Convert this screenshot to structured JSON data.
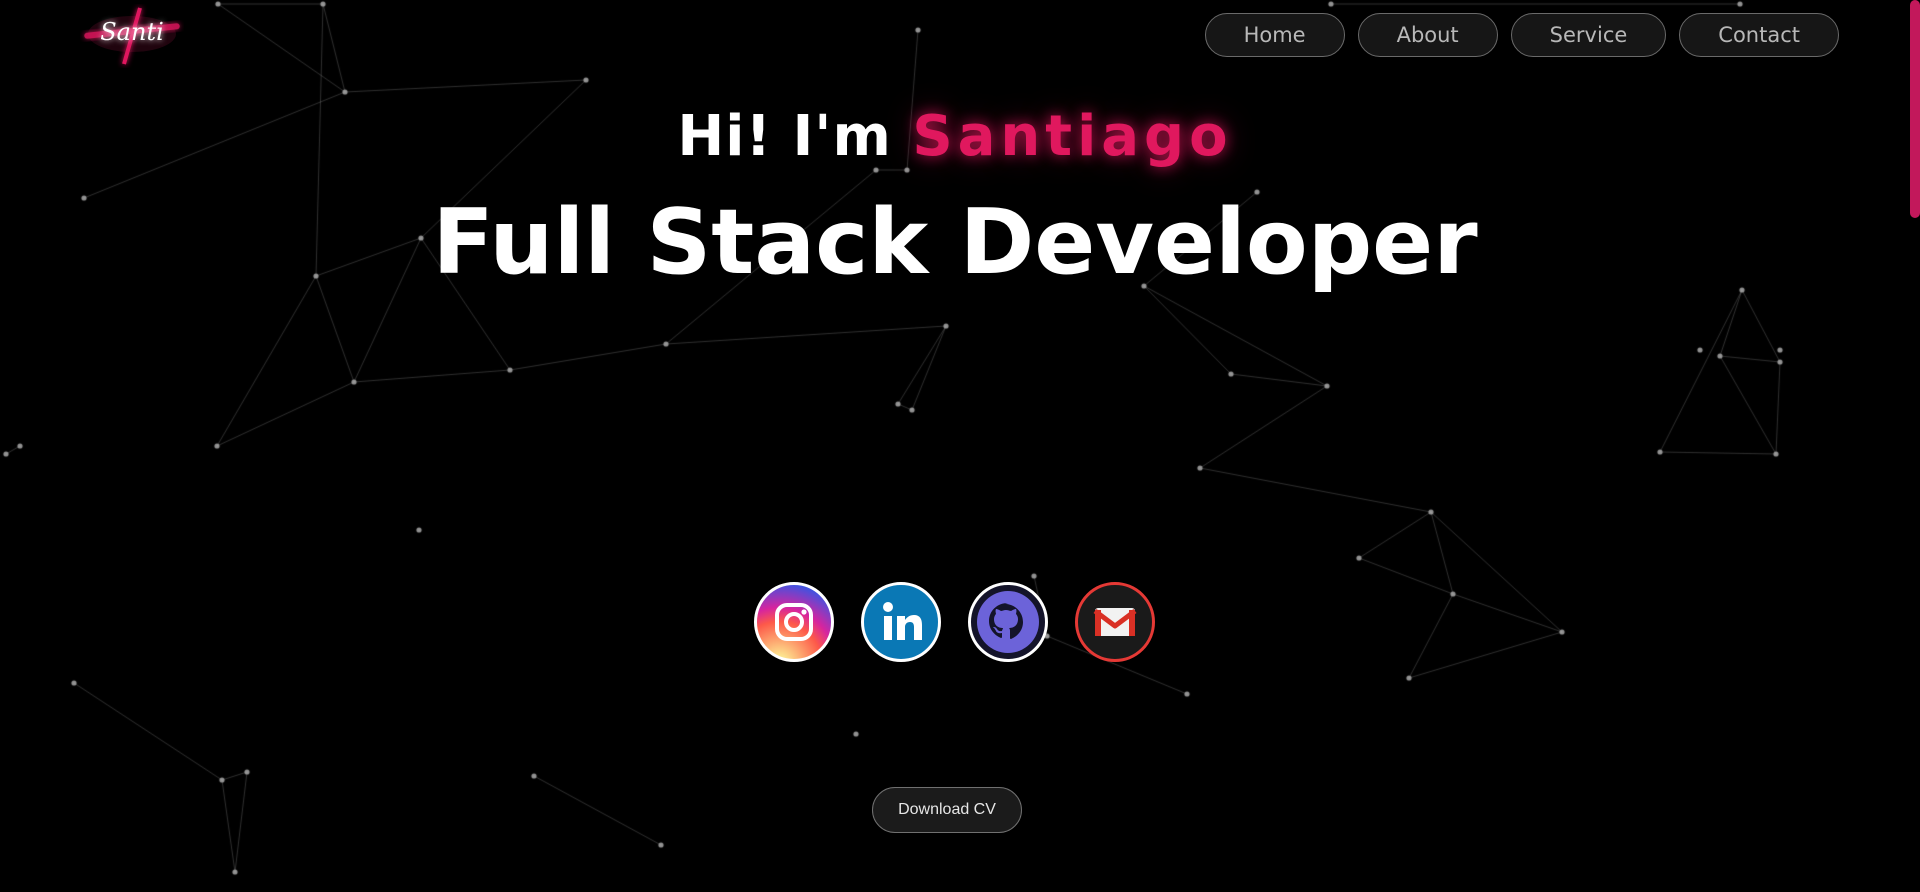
{
  "logo": {
    "text": "Santi",
    "icon": "neon-logo-icon"
  },
  "nav": {
    "items": [
      {
        "label": "Home"
      },
      {
        "label": "About"
      },
      {
        "label": "Service"
      },
      {
        "label": "Contact"
      }
    ]
  },
  "hero": {
    "greeting": "Hi! I'm",
    "name": "Santiago",
    "title": "Full Stack Developer"
  },
  "socials": [
    {
      "icon": "instagram-icon"
    },
    {
      "icon": "linkedin-icon"
    },
    {
      "icon": "github-icon"
    },
    {
      "icon": "gmail-icon"
    }
  ],
  "download": {
    "label": "Download CV"
  },
  "colors": {
    "background": "#000000",
    "accent": "#e0185e",
    "text": "#ffffff",
    "nav_text": "#b8b8b8"
  }
}
